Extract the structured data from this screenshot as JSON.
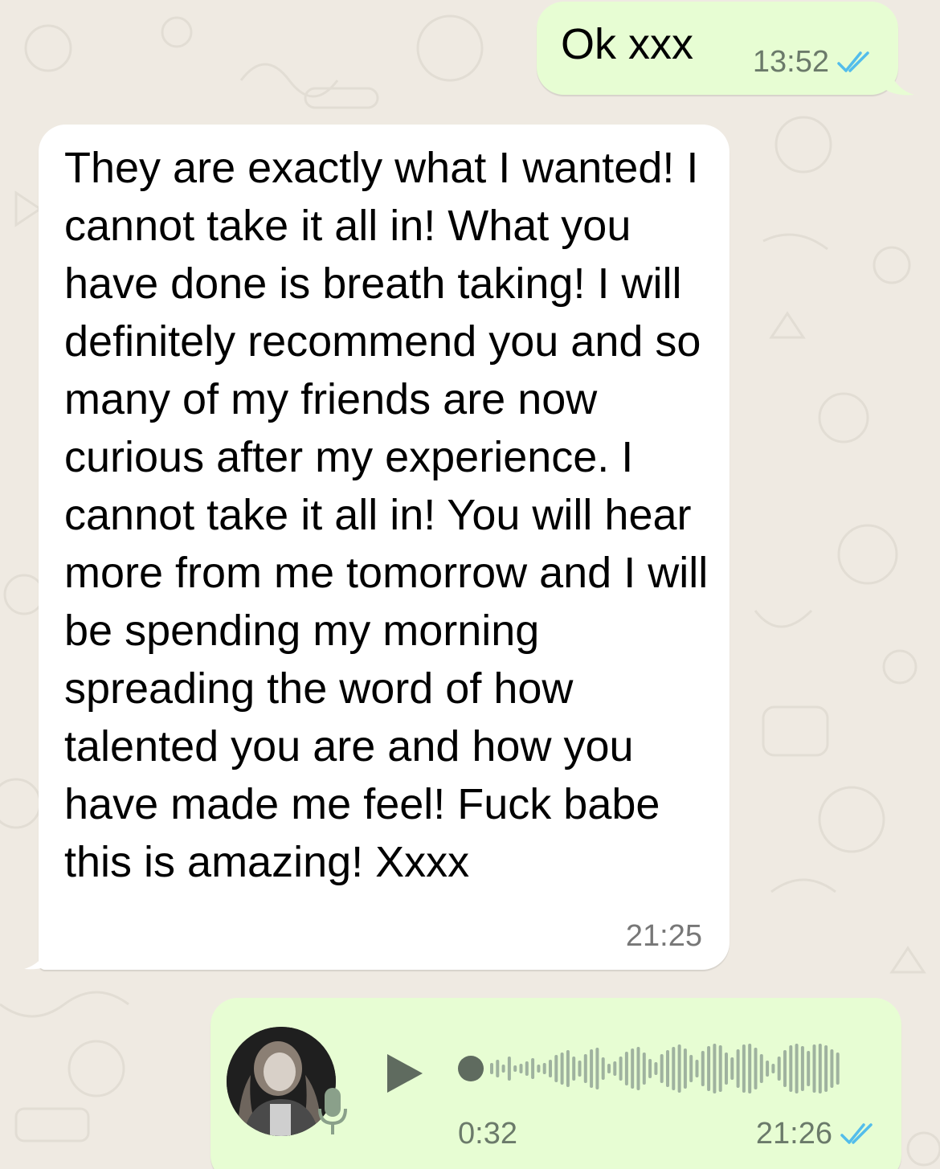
{
  "messages": [
    {
      "direction": "outgoing",
      "text": "Ok xxx",
      "time": "13:52",
      "status_icon": "double-check-read-icon"
    },
    {
      "direction": "incoming",
      "text": "They are exactly what I wanted! I cannot take it all in! What you have done is breath taking! I will definitely recommend you and so many of my friends are now curious after my experience. I cannot take it all in! You will hear more from me tomorrow and I will be spending my morning spreading the word of how talented you are and how you have made me feel! Fuck babe this is amazing! Xxxx",
      "time": "21:25"
    },
    {
      "direction": "outgoing",
      "type": "voice",
      "duration": "0:32",
      "time": "21:26",
      "status_icon": "double-check-read-icon",
      "playback_progress": 0
    }
  ],
  "colors": {
    "wallpaper": "#efeae2",
    "outgoing_bubble": "#e7fdd3",
    "incoming_bubble": "#ffffff",
    "read_ticks": "#53bdeb",
    "waveform": "#8aa08a"
  }
}
